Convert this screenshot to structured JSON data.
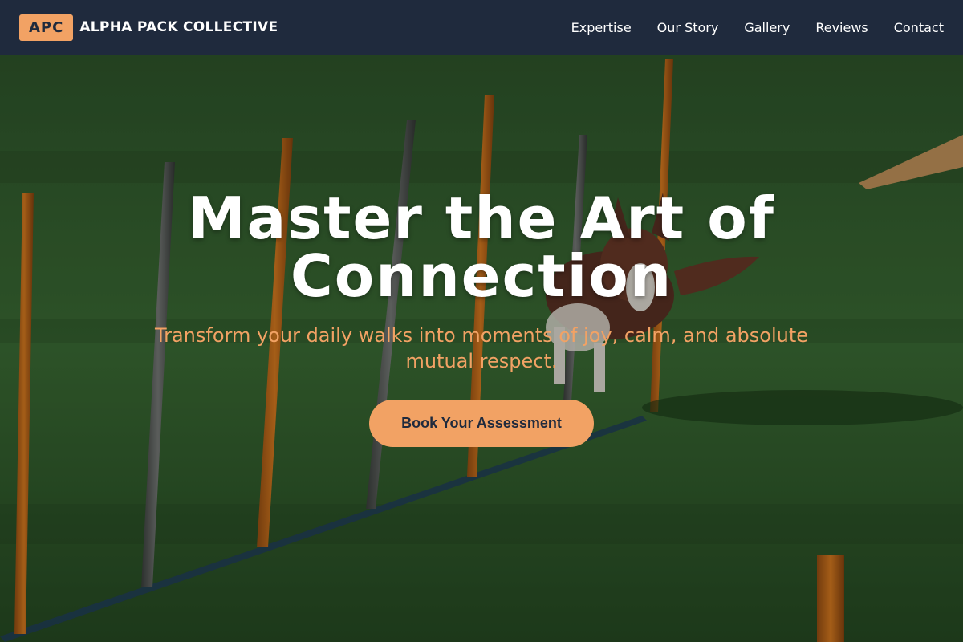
{
  "brand": {
    "logo_text": "APC",
    "name": "ALPHA PACK COLLECTIVE"
  },
  "nav": {
    "links": [
      "Expertise",
      "Our Story",
      "Gallery",
      "Reviews",
      "Contact"
    ]
  },
  "hero": {
    "title": "Master the Art of Connection",
    "subtitle": "Transform your daily walks into moments of joy, calm, and absolute mutual respect.",
    "cta_label": "Book Your Assessment",
    "background_image": "dog running through agility weave poles on artificial turf"
  },
  "colors": {
    "nav_bg": "#1f2a3d",
    "accent": "#f2a264",
    "title_text": "#ffffff",
    "turf": "#2f5a2c"
  }
}
